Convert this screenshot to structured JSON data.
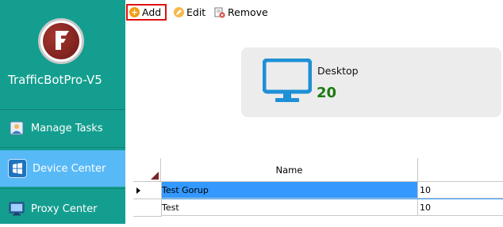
{
  "app": {
    "title": "TrafficBotPro-V5"
  },
  "sidebar": {
    "items": [
      {
        "label": "Manage Tasks",
        "icon": "user-badge-icon",
        "active": false
      },
      {
        "label": "Device Center",
        "icon": "windows-logo-icon",
        "active": true
      },
      {
        "label": "Proxy Center",
        "icon": "proxy-screen-icon",
        "active": false
      }
    ]
  },
  "toolbar": {
    "add_label": "Add",
    "edit_label": "Edit",
    "remove_label": "Remove"
  },
  "device_card": {
    "title": "Desktop",
    "count": "20",
    "icon": "desktop-monitor-icon"
  },
  "grid": {
    "columns": [
      "Name",
      ""
    ],
    "rows": [
      {
        "name": "Test Gorup",
        "count": "10",
        "selected": true
      },
      {
        "name": "Test",
        "count": "10",
        "selected": false
      }
    ]
  },
  "colors": {
    "sidebar_bg": "#149e8f",
    "active_item": "#58b9f7",
    "selection": "#3399ff",
    "count_green": "#1d7a12",
    "monitor_blue": "#1e90d6",
    "highlight_border": "#e01010"
  }
}
